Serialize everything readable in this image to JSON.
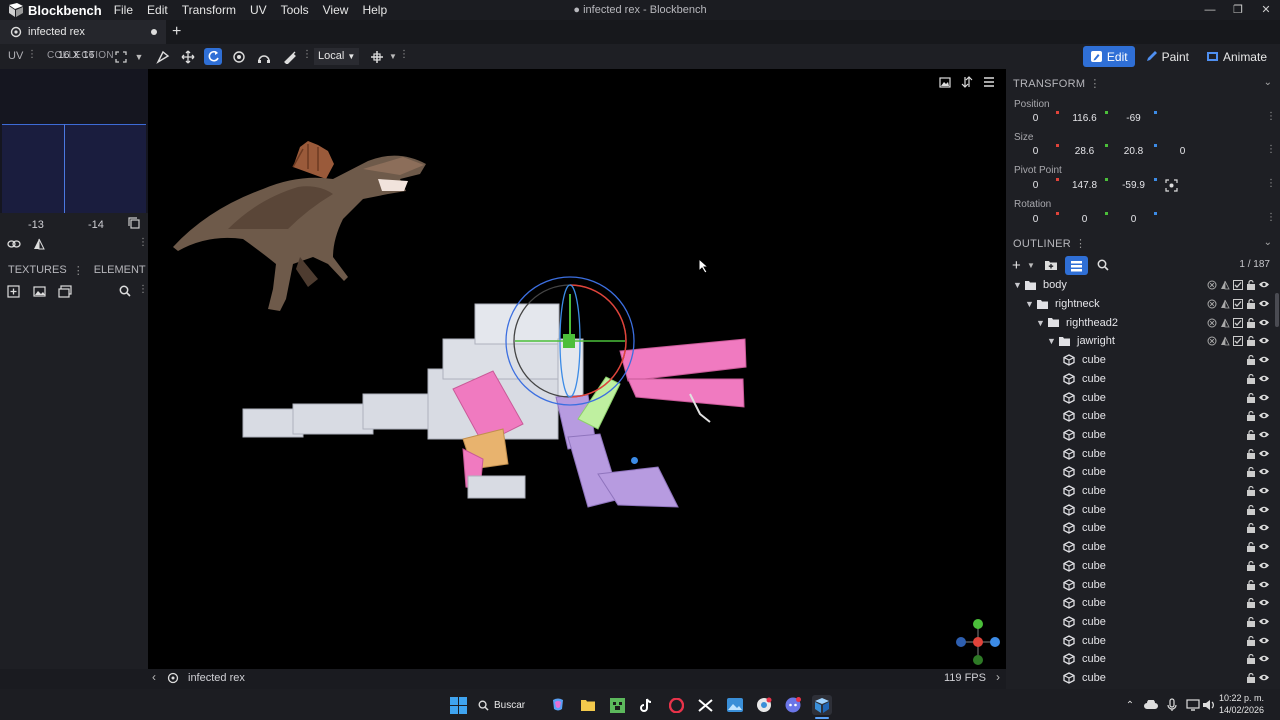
{
  "app": {
    "name": "Blockbench",
    "window_title": "● infected rex - Blockbench",
    "menu": [
      "File",
      "Edit",
      "Transform",
      "UV",
      "Tools",
      "View",
      "Help"
    ]
  },
  "tabs": [
    {
      "label": "infected rex",
      "unsaved": true
    }
  ],
  "toolbar": {
    "uv_label": "UV",
    "uv_mode_text": "16 X 16",
    "uv_mode_overlay": "COLLECTION",
    "space_select": "Local",
    "modes": [
      {
        "label": "Edit",
        "active": true
      },
      {
        "label": "Paint",
        "active": false
      },
      {
        "label": "Animate",
        "active": false
      }
    ]
  },
  "left_panel": {
    "uv_coords": [
      "-13",
      "-14"
    ],
    "textures_label": "TEXTURES",
    "element_label": "ELEMENT"
  },
  "transform": {
    "title": "TRANSFORM",
    "position_label": "Position",
    "position": [
      "0",
      "116.6",
      "-69"
    ],
    "size_label": "Size",
    "size": [
      "0",
      "28.6",
      "20.8",
      "0"
    ],
    "pivot_label": "Pivot Point",
    "pivot": [
      "0",
      "147.8",
      "-59.9"
    ],
    "rotation_label": "Rotation",
    "rotation": [
      "0",
      "0",
      "0"
    ]
  },
  "outliner": {
    "title": "OUTLINER",
    "count": "1 / 187",
    "groups": [
      {
        "name": "body",
        "level": 0
      },
      {
        "name": "rightneck",
        "level": 1
      },
      {
        "name": "righthead2",
        "level": 2
      },
      {
        "name": "jawright",
        "level": 3
      }
    ],
    "cubes": [
      "cube",
      "cube",
      "cube",
      "cube",
      "cube",
      "cube",
      "cube",
      "cube",
      "cube",
      "cube",
      "cube",
      "cube",
      "cube",
      "cube",
      "cube",
      "cube",
      "cube",
      "cube"
    ]
  },
  "status": {
    "project_name": "infected rex",
    "fps": "119 FPS"
  },
  "taskbar": {
    "search_label": "Buscar",
    "time": "10:22 p. m.",
    "date": "14/02/2026"
  },
  "colors": {
    "accent": "#2f6fd6",
    "axis_x": "#e0433a",
    "axis_y": "#4bbf3a",
    "axis_z": "#3c8be6",
    "model_white": "#d8dbe3",
    "model_pink": "#f07ac0",
    "model_purple": "#b79be0"
  }
}
